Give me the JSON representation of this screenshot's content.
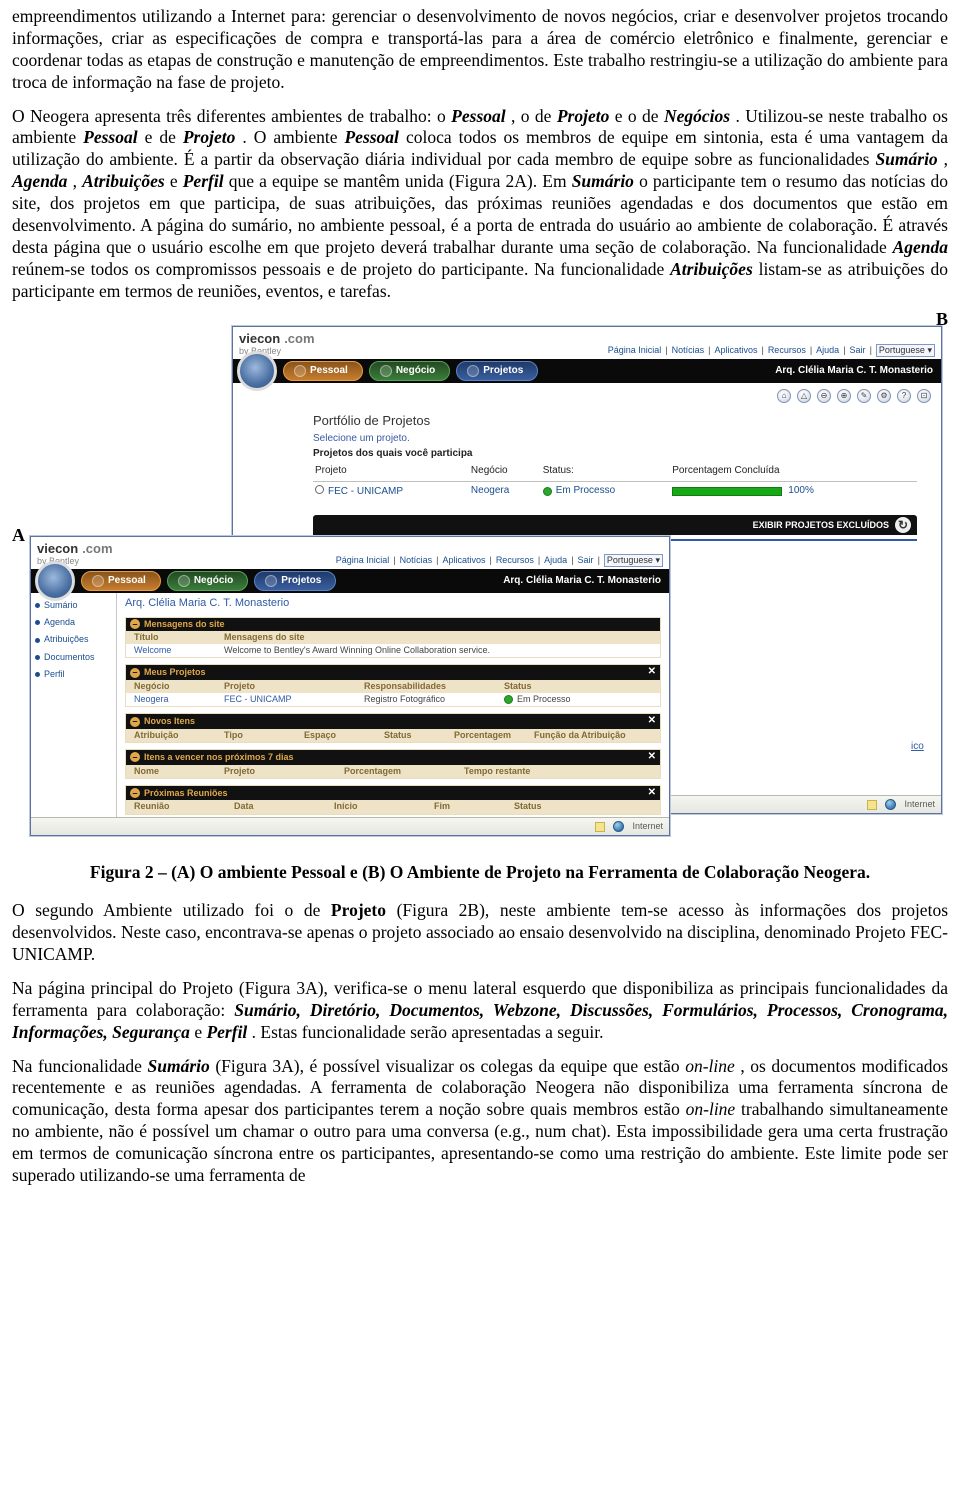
{
  "paragraph1": "empreendimentos utilizando a Internet para: gerenciar o desenvolvimento de novos negócios, criar e desenvolver projetos trocando informações, criar as especificações de compra e transportá-las para a área de comércio eletrônico e finalmente, gerenciar e coordenar todas as etapas de construção e manutenção de empreendimentos. Este trabalho restringiu-se a utilização do ambiente para troca de informação na fase de projeto.",
  "paragraph2": {
    "a": "O Neogera apresenta três diferentes ambientes de trabalho: o ",
    "pessoal": "Pessoal",
    "b": ", o de ",
    "projeto": "Projeto",
    "c": " e o de ",
    "negocios": "Negócios",
    "d": ". Utilizou-se neste trabalho os ambiente ",
    "pessoal2": "Pessoal",
    "e": " e de ",
    "projeto2": "Projeto",
    "f": ". O ambiente ",
    "pessoal3": "Pessoal",
    "g": " coloca todos os membros de equipe em sintonia, esta é uma vantagem da utilização do ambiente. É a partir da observação diária individual por cada membro de equipe sobre as funcionalidades ",
    "sumario": "Sumário",
    "h": ", ",
    "agenda": "Agenda",
    "i": ", ",
    "atribuicoes": "Atribuições",
    "j": " e ",
    "perfil": "Perfil",
    "k": " que a equipe se mantêm unida (Figura 2A). Em ",
    "sumario2": "Sumário",
    "l": " o participante tem o resumo das notícias do site, dos projetos em que participa, de suas atribuições, das próximas reuniões agendadas e dos documentos que estão em desenvolvimento. A página do sumário, no ambiente pessoal, é a porta de entrada do usuário ao ambiente de colaboração. É através desta página que o usuário escolhe em que projeto deverá trabalhar durante uma seção de colaboração. Na funcionalidade ",
    "agenda2": "Agenda",
    "m": " reúnem-se todos os compromissos pessoais e de projeto do participante. Na funcionalidade ",
    "atribuicoes2": "Atribuições",
    "n": " listam-se as atribuições do participante em termos de reuniões, eventos, e tarefas."
  },
  "labelA": "A",
  "labelB": "B",
  "caption": "Figura 2 – (A) O ambiente Pessoal e (B) O Ambiente de Projeto na Ferramenta de Colaboração Neogera.",
  "paragraph3": {
    "a": "O segundo Ambiente utilizado foi o de ",
    "projeto": "Projeto",
    "b": " (Figura 2B), neste ambiente tem-se acesso às informações dos projetos desenvolvidos. Neste caso, encontrava-se apenas o projeto associado ao ensaio desenvolvido na disciplina, denominado Projeto FEC-UNICAMP."
  },
  "paragraph4": {
    "a": "Na página principal do Projeto (Figura 3A), verifica-se o menu lateral esquerdo que disponibiliza as principais funcionalidades da ferramenta para colaboração: ",
    "list": "Sumário, Diretório, Documentos, Webzone, Discussões, Formulários, Processos, Cronograma, Informações, Segurança",
    "b": " e ",
    "perfil": "Perfil",
    "c": ". Estas funcionalidade serão apresentadas a seguir."
  },
  "paragraph5": {
    "a": "Na funcionalidade ",
    "sumario": "Sumário",
    "b": " (Figura 3A), é possível visualizar os colegas da equipe que estão ",
    "online1": "on-line",
    "c": ", os documentos modificados recentemente e as reuniões agendadas. A ferramenta de colaboração Neogera não disponibiliza uma ferramenta síncrona de comunicação, desta forma apesar dos participantes terem a noção sobre quais membros estão ",
    "online2": "on-line",
    "d": " trabalhando simultaneamente no ambiente, não é possível um chamar o outro para uma conversa (e.g., num chat). Esta impossibilidade gera uma certa frustração em termos de comunicação síncrona entre os participantes, apresentando-se como uma restrição do ambiente. Este limite pode ser superado utilizando-se uma ferramenta de"
  },
  "brand": {
    "v": "viecon",
    "com": ".com",
    "by": "by Bentley"
  },
  "topnav": {
    "items": [
      "Página Inicial",
      "Notícias",
      "Aplicativos",
      "Recursos",
      "Ajuda",
      "Sair"
    ],
    "language": "Portuguese"
  },
  "tabs": {
    "pessoal": "Pessoal",
    "negocio": "Negócio",
    "projetos": "Projetos"
  },
  "userName": "Arq. Clélia Maria C. T. Monasterio",
  "toolbarGlyphs": [
    "⌂",
    "△",
    "⊖",
    "⊕",
    "✎",
    "⚙",
    "?",
    "⊡"
  ],
  "windowB": {
    "title": "Portfólio de Projetos",
    "selectHint": "Selecione um projeto.",
    "listTitle": "Projetos dos quais você participa",
    "cols": {
      "projeto": "Projeto",
      "negocio": "Negócio",
      "status": "Status:",
      "pct": "Porcentagem Concluída"
    },
    "row": {
      "projeto": "FEC - UNICAMP",
      "negocio": "Neogera",
      "status": "Em Processo",
      "pct": "100%"
    },
    "exibir": "EXIBIR PROJETOS EXCLUÍDOS",
    "ico_cut": "ico"
  },
  "windowA": {
    "side": [
      "Sumário",
      "Agenda",
      "Atribuições",
      "Documentos",
      "Perfil"
    ],
    "user": "Arq. Clélia Maria C. T. Monasterio",
    "sec_msg": {
      "title": "Mensagens do site",
      "cols": [
        "Título",
        "Mensagens do site"
      ],
      "row": [
        "Welcome",
        "Welcome to Bentley's Award Winning Online Collaboration service."
      ]
    },
    "sec_proj": {
      "title": "Meus Projetos",
      "cols": [
        "Negócio",
        "Projeto",
        "Responsabilidades",
        "Status"
      ],
      "row": [
        "Neogera",
        "FEC - UNICAMP",
        "Registro Fotográfico",
        "Em Processo"
      ]
    },
    "sec_novos": {
      "title": "Novos Itens",
      "cols": [
        "Atribuição",
        "Tipo",
        "Espaço",
        "Status",
        "Porcentagem",
        "Função da Atribuição"
      ]
    },
    "sec_vencer": {
      "title": "Itens a vencer nos próximos 7 dias",
      "cols": [
        "Nome",
        "Projeto",
        "Porcentagem",
        "Tempo restante"
      ]
    },
    "sec_reunioes": {
      "title": "Próximas Reuniões",
      "cols": [
        "Reunião",
        "Data",
        "Início",
        "Fim",
        "Status"
      ]
    },
    "statusbar": "Internet"
  }
}
